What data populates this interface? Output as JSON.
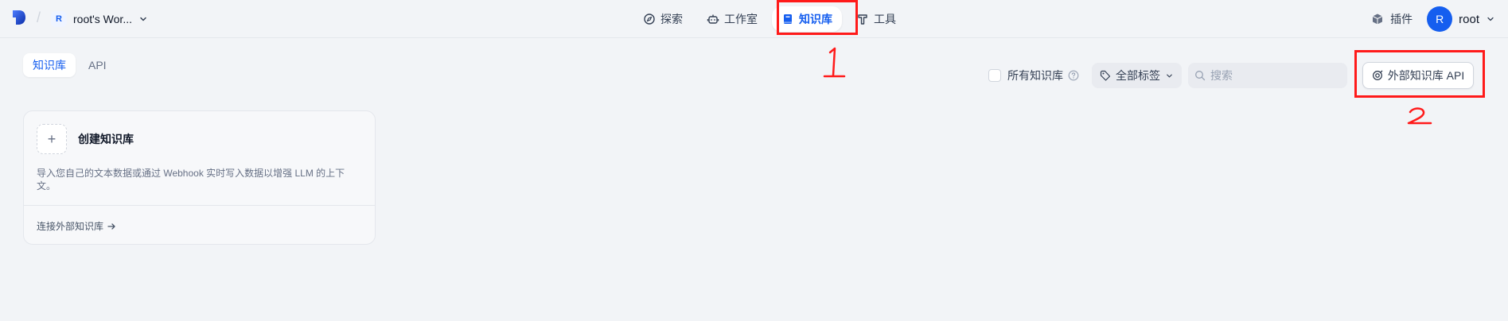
{
  "header": {
    "workspace": {
      "avatar_letter": "R",
      "name": "root's Wor..."
    },
    "nav": [
      {
        "id": "explore",
        "label": "探索",
        "icon": "compass-icon"
      },
      {
        "id": "studio",
        "label": "工作室",
        "icon": "robot-icon"
      },
      {
        "id": "knowledge",
        "label": "知识库",
        "icon": "book-icon",
        "active": true
      },
      {
        "id": "tools",
        "label": "工具",
        "icon": "hammer-icon"
      }
    ],
    "plugins_label": "插件",
    "user": {
      "avatar_letter": "R",
      "name": "root"
    }
  },
  "tabs": [
    {
      "label": "知识库",
      "active": true
    },
    {
      "label": "API",
      "active": false
    }
  ],
  "filters": {
    "all_knowledge_label": "所有知识库",
    "all_knowledge_checked": false,
    "tag_filter_label": "全部标签",
    "search_placeholder": "搜索"
  },
  "external_api_button_label": "外部知识库 API",
  "create_card": {
    "plus": "+",
    "title": "创建知识库",
    "description": "导入您自己的文本数据或通过 Webhook 实时写入数据以增强 LLM 的上下文。",
    "link_label": "连接外部知识库"
  },
  "annotations": {
    "label_1": "1",
    "label_2": "2",
    "color": "#ff1a1a"
  },
  "colors": {
    "accent": "#155eef",
    "background": "#f2f4f7"
  }
}
